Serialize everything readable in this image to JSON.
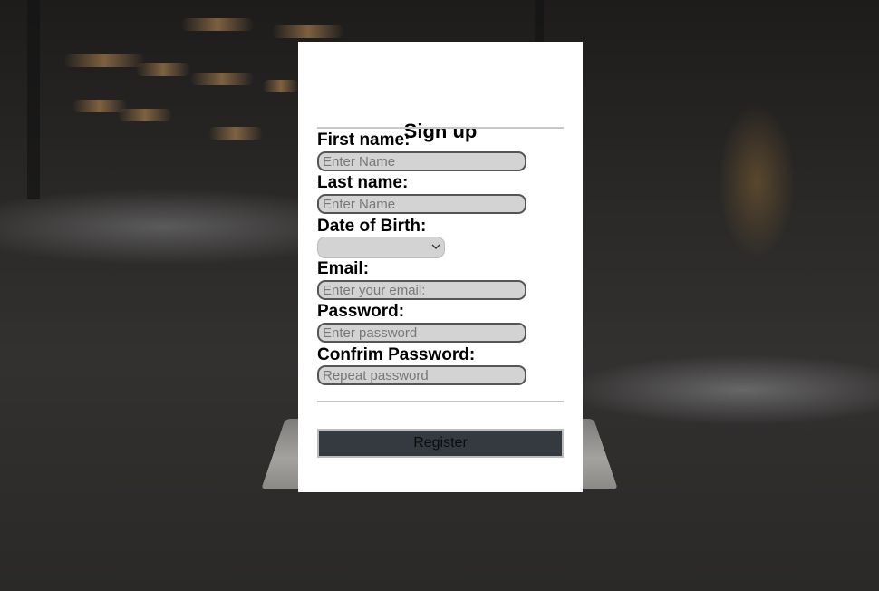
{
  "form": {
    "title": "Sign up",
    "fields": [
      {
        "label": "First name:",
        "placeholder": "Enter Name",
        "type": "text"
      },
      {
        "label": "Last name:",
        "placeholder": "Enter Name",
        "type": "text"
      },
      {
        "label": "Date of Birth:",
        "type": "select",
        "value": ""
      },
      {
        "label": "Email:",
        "placeholder": "Enter your email:",
        "type": "email"
      },
      {
        "label": "Password:",
        "placeholder": "Enter password",
        "type": "password"
      },
      {
        "label": "Confrim Password:",
        "placeholder": "Repeat password",
        "type": "password"
      }
    ],
    "submit_label": "Register"
  },
  "colors": {
    "card_background": "#ffffff",
    "input_background": "#d3d3d3",
    "button_background": "#343a40"
  },
  "icons": {
    "select_arrow": "chevron-down-icon"
  }
}
